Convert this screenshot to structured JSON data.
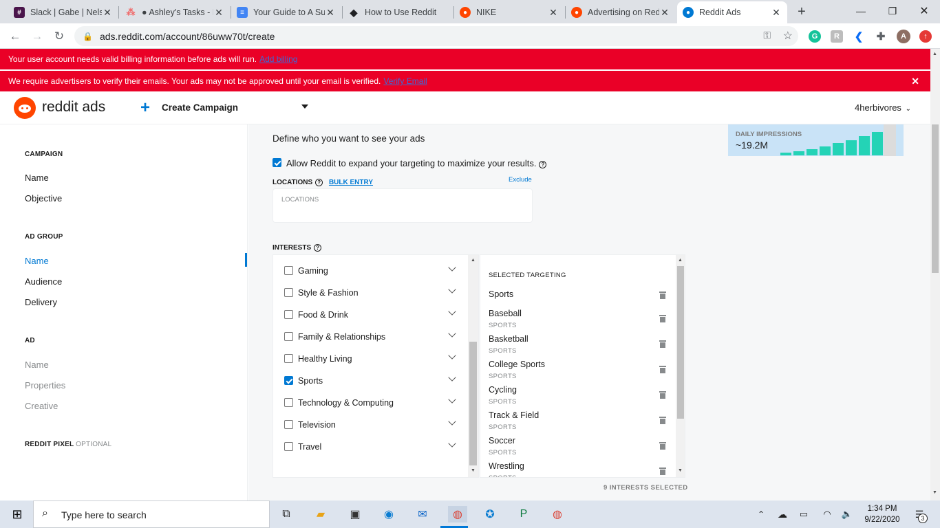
{
  "browser": {
    "tabs": [
      {
        "title": "Slack | Gabe | Nels",
        "favicon": "slack-icon",
        "color": "#4a154b"
      },
      {
        "title": "● Ashley's Tasks - I",
        "favicon": "asana-icon",
        "color": "#f06a6a"
      },
      {
        "title": "Your Guide to A Su",
        "favicon": "google-docs-icon",
        "color": "#4285f4"
      },
      {
        "title": "How to Use Reddit",
        "favicon": "bookmark-icon",
        "color": "#202124"
      },
      {
        "title": "NIKE",
        "favicon": "reddit-icon",
        "color": "#ff4500"
      },
      {
        "title": "Advertising on Red",
        "favicon": "reddit-icon",
        "color": "#ff4500"
      },
      {
        "title": "Reddit Ads",
        "favicon": "reddit-ads-icon",
        "color": "#0079d3"
      }
    ],
    "new_tab": "+",
    "url": "ads.reddit.com/account/86uww70t/create",
    "profile_initial": "A"
  },
  "banners": {
    "billing": {
      "text": "Your user account needs valid billing information before ads will run.",
      "link": "Add billing"
    },
    "verify": {
      "text": "We require advertisers to verify their emails. Your ads may not be approved until your email is verified.",
      "link": "Verify Email",
      "close": "✕"
    }
  },
  "header": {
    "logo_text": "reddit ads",
    "create_label": "Create Campaign",
    "account": "4herbivores"
  },
  "sidebar": {
    "campaign_heading": "CAMPAIGN",
    "campaign_items": [
      "Name",
      "Objective"
    ],
    "adgroup_heading": "AD GROUP",
    "adgroup_items": [
      "Name",
      "Audience",
      "Delivery"
    ],
    "ad_heading": "AD",
    "ad_items": [
      "Name",
      "Properties",
      "Creative"
    ],
    "pixel_heading": "REDDIT PIXEL",
    "pixel_optional": "OPTIONAL"
  },
  "main": {
    "define_text": "Define who you want to see your ads",
    "expand_label": "Allow Reddit to expand your targeting to maximize your results.",
    "expand_checked": true,
    "locations_label": "LOCATIONS",
    "bulk_entry": "BULK ENTRY",
    "exclude": "Exclude",
    "locations_placeholder": "LOCATIONS",
    "interests_label": "INTERESTS",
    "interests": [
      {
        "label": "Gaming",
        "checked": false
      },
      {
        "label": "Style & Fashion",
        "checked": false
      },
      {
        "label": "Food & Drink",
        "checked": false
      },
      {
        "label": "Family & Relationships",
        "checked": false
      },
      {
        "label": "Healthy Living",
        "checked": false
      },
      {
        "label": "Sports",
        "checked": true
      },
      {
        "label": "Technology & Computing",
        "checked": false
      },
      {
        "label": "Television",
        "checked": false
      },
      {
        "label": "Travel",
        "checked": false
      }
    ],
    "selected_heading": "SELECTED TARGETING",
    "selected_top": "Sports",
    "selected": [
      {
        "name": "Baseball",
        "category": "SPORTS"
      },
      {
        "name": "Basketball",
        "category": "SPORTS"
      },
      {
        "name": "College Sports",
        "category": "SPORTS"
      },
      {
        "name": "Cycling",
        "category": "SPORTS"
      },
      {
        "name": "Track & Field",
        "category": "SPORTS"
      },
      {
        "name": "Soccer",
        "category": "SPORTS"
      },
      {
        "name": "Wrestling",
        "category": "SPORTS"
      }
    ],
    "selected_count": "9 INTERESTS SELECTED"
  },
  "impressions": {
    "label": "DAILY IMPRESSIONS",
    "value": "~19.2M",
    "bars": [
      0.1,
      0.14,
      0.22,
      0.32,
      0.44,
      0.55,
      0.7,
      0.85,
      1.0
    ]
  },
  "taskbar": {
    "search_placeholder": "Type here to search",
    "time": "1:34 PM",
    "date": "9/22/2020",
    "notifications": "3"
  },
  "colors": {
    "banner_red": "#ea0027",
    "reddit_orange": "#ff4500",
    "accent_blue": "#0079d3",
    "impressions_teal": "#24d3b6"
  }
}
